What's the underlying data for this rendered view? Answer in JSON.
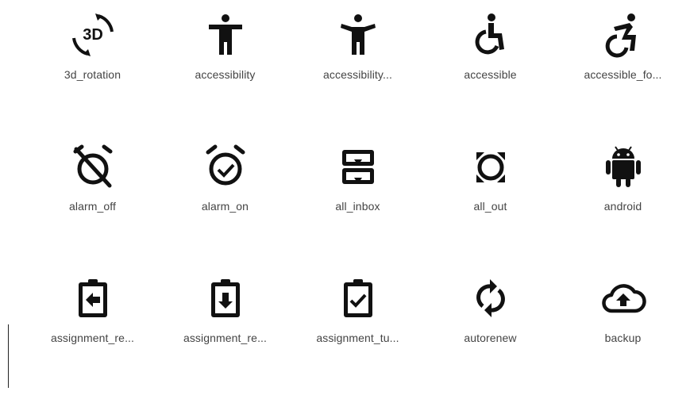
{
  "icon_color": "#111111",
  "rows": [
    [
      {
        "icon": "3d-rotation-icon",
        "label": "3d_rotation"
      },
      {
        "icon": "accessibility-icon",
        "label": "accessibility"
      },
      {
        "icon": "accessibility-new-icon",
        "label": "accessibility..."
      },
      {
        "icon": "accessible-icon",
        "label": "accessible"
      },
      {
        "icon": "accessible-forward-icon",
        "label": "accessible_fo..."
      }
    ],
    [
      {
        "icon": "alarm-off-icon",
        "label": "alarm_off"
      },
      {
        "icon": "alarm-on-icon",
        "label": "alarm_on"
      },
      {
        "icon": "all-inbox-icon",
        "label": "all_inbox"
      },
      {
        "icon": "all-out-icon",
        "label": "all_out"
      },
      {
        "icon": "android-icon",
        "label": "android"
      }
    ],
    [
      {
        "icon": "assignment-return-icon",
        "label": "assignment_re..."
      },
      {
        "icon": "assignment-returned-icon",
        "label": "assignment_re..."
      },
      {
        "icon": "assignment-turned-in-icon",
        "label": "assignment_tu..."
      },
      {
        "icon": "autorenew-icon",
        "label": "autorenew"
      },
      {
        "icon": "backup-icon",
        "label": "backup"
      }
    ]
  ]
}
